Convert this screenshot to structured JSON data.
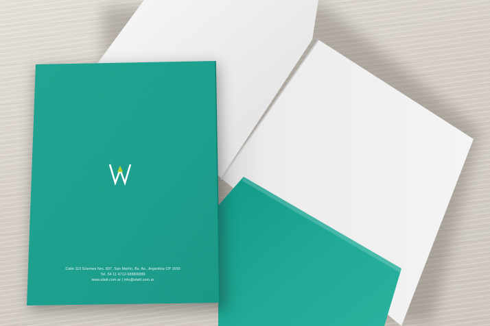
{
  "scene": {
    "subject": "folder-mockup",
    "colors": {
      "folder_teal": "#14a08d",
      "folder_teal_dark": "#0d8d7b",
      "paper_white": "#f2f2f2",
      "table_wood": "#dbd5cc"
    }
  },
  "cover": {
    "logo_icon": "aw-monogram",
    "address_line": "Calle 113 Güemes Nro. 837, San Martín, Bs. As., Argentina CP 1650",
    "phone_line": "Tel. 54 11 4712-6888/6889",
    "web_line": "www.alwit.com.ar | info@alwit.com.ar"
  }
}
